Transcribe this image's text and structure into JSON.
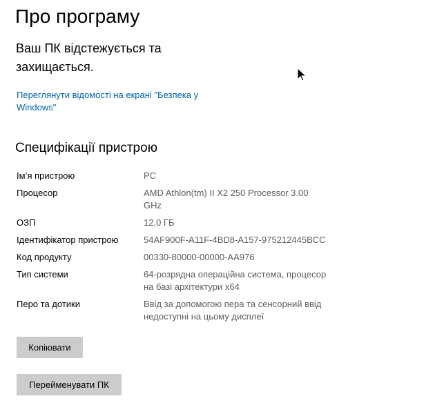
{
  "page": {
    "title": "Про програму"
  },
  "security": {
    "status": "Ваш ПК відстежується та захищається.",
    "link": "Переглянути відомості на екрані \"Безпека у Windows\""
  },
  "specs": {
    "heading": "Специфікації пристрою",
    "rows": [
      {
        "label": "Ім’я пристрою",
        "value": "PC"
      },
      {
        "label": "Процесор",
        "value": "AMD Athlon(tm) II X2 250 Processor   3.00 GHz"
      },
      {
        "label": "ОЗП",
        "value": "12,0 ГБ"
      },
      {
        "label": "Ідентифікатор пристрою",
        "value": "54AF900F-A11F-4BD8-A157-975212445BCC"
      },
      {
        "label": "Код продукту",
        "value": "00330-80000-00000-AA976"
      },
      {
        "label": "Тип системи",
        "value": "64-розрядна операційна система, процесор на базі архітектури x64"
      },
      {
        "label": "Перо та дотики",
        "value": "Ввід за допомогою пера та сенсорний ввід недоступні на цьому дисплеї"
      }
    ]
  },
  "buttons": {
    "copy": "Копіювати",
    "rename": "Перейменувати ПК"
  },
  "icons": {
    "cursor": "mouse-pointer-icon"
  },
  "colors": {
    "link": "#0063b1",
    "value_text": "#5c5c5c",
    "button_bg": "#cccccc"
  }
}
